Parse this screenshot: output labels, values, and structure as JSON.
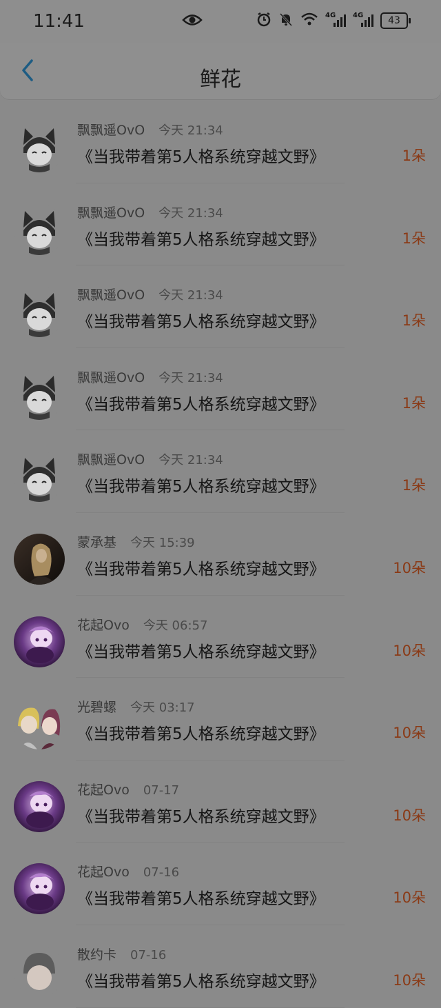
{
  "status": {
    "time": "11:41",
    "battery": "43",
    "signal_label_1": "4G",
    "signal_label_2": "4G"
  },
  "header": {
    "title": "鲜花"
  },
  "items": [
    {
      "name": "飘飘遥OvO",
      "time": "今天 21:34",
      "book": "《当我带着第5人格系统穿越文野》",
      "qty": "1朵",
      "avatar": "cat"
    },
    {
      "name": "飘飘遥OvO",
      "time": "今天 21:34",
      "book": "《当我带着第5人格系统穿越文野》",
      "qty": "1朵",
      "avatar": "cat"
    },
    {
      "name": "飘飘遥OvO",
      "time": "今天 21:34",
      "book": "《当我带着第5人格系统穿越文野》",
      "qty": "1朵",
      "avatar": "cat"
    },
    {
      "name": "飘飘遥OvO",
      "time": "今天 21:34",
      "book": "《当我带着第5人格系统穿越文野》",
      "qty": "1朵",
      "avatar": "cat"
    },
    {
      "name": "飘飘遥OvO",
      "time": "今天 21:34",
      "book": "《当我带着第5人格系统穿越文野》",
      "qty": "1朵",
      "avatar": "cat"
    },
    {
      "name": "蒙承基",
      "time": "今天 15:39",
      "book": "《当我带着第5人格系统穿越文野》",
      "qty": "10朵",
      "avatar": "photo"
    },
    {
      "name": "花起Ovo",
      "time": "今天 06:57",
      "book": "《当我带着第5人格系统穿越文野》",
      "qty": "10朵",
      "avatar": "purple"
    },
    {
      "name": "光碧螺",
      "time": "今天 03:17",
      "book": "《当我带着第5人格系统穿越文野》",
      "qty": "10朵",
      "avatar": "duo"
    },
    {
      "name": "花起Ovo",
      "time": "07-17",
      "book": "《当我带着第5人格系统穿越文野》",
      "qty": "10朵",
      "avatar": "purple"
    },
    {
      "name": "花起Ovo",
      "time": "07-16",
      "book": "《当我带着第5人格系统穿越文野》",
      "qty": "10朵",
      "avatar": "purple"
    },
    {
      "name": "散约卡",
      "time": "07-16",
      "book": "《当我带着第5人格系统穿越文野》",
      "qty": "10朵",
      "avatar": "grey"
    }
  ]
}
